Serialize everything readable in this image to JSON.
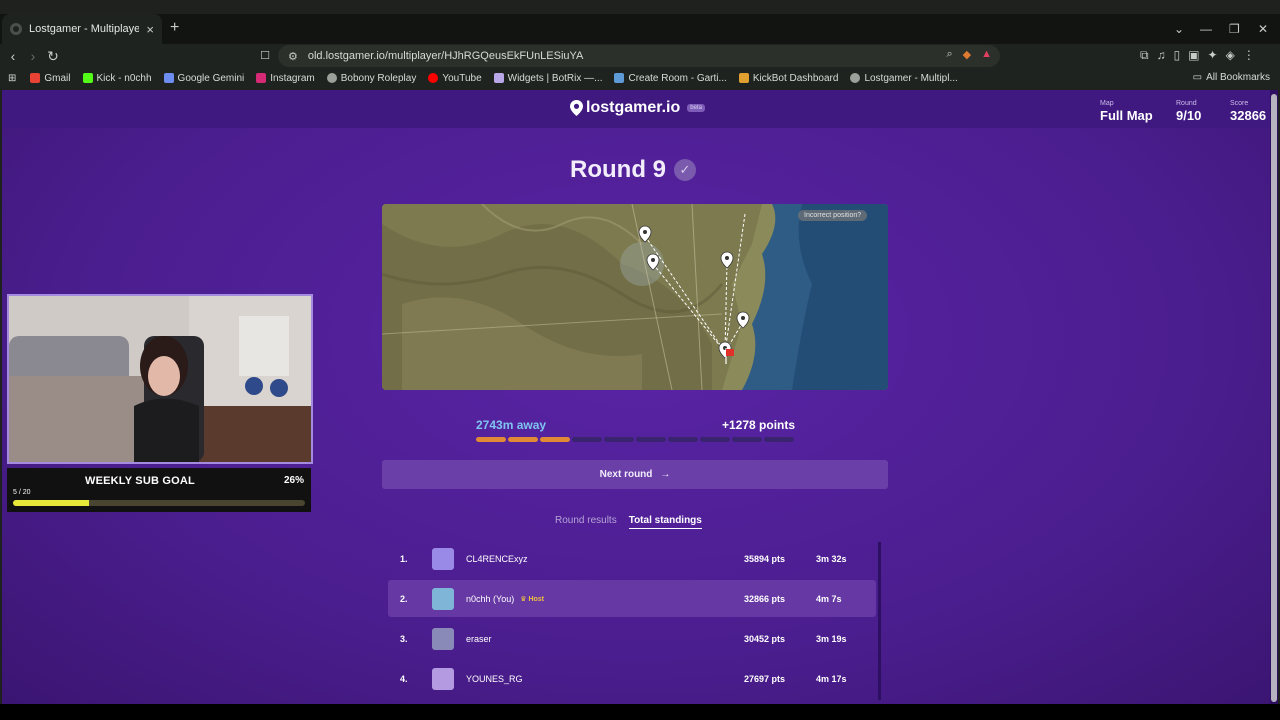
{
  "browser": {
    "tab_title": "Lostgamer - Multiplayer",
    "url": "old.lostgamer.io/multiplayer/HJhRGQeusEkFUnLESiuYA",
    "bookmarks": [
      {
        "label": "Gmail",
        "color": "#ea4335"
      },
      {
        "label": "Kick - n0chh",
        "color": "#53fc18"
      },
      {
        "label": "Google Gemini",
        "color": "#6e8df0"
      },
      {
        "label": "Instagram",
        "color": "#d62976"
      },
      {
        "label": "Bobony Roleplay",
        "color": "#9aa09a"
      },
      {
        "label": "YouTube",
        "color": "#ff0000"
      },
      {
        "label": "Widgets | BotRix —...",
        "color": "#b9a6e8"
      },
      {
        "label": "Create Room - Garti...",
        "color": "#5f9ad8"
      },
      {
        "label": "KickBot Dashboard",
        "color": "#e0a030"
      },
      {
        "label": "Lostgamer - Multipl...",
        "color": "#9aa09a"
      }
    ],
    "all_bookmarks": "All Bookmarks"
  },
  "header": {
    "logo_text": "lostgamer.io",
    "beta": "beta",
    "map_label": "Map",
    "map_value": "Full Map",
    "round_label": "Round",
    "round_value": "9/10",
    "score_label": "Score",
    "score_value": "32866"
  },
  "round": {
    "title": "Round 9",
    "map_tag": "Incorrect position?",
    "distance": "2743m away",
    "points": "+1278 points",
    "score_fraction": 0.3,
    "next_button": "Next round"
  },
  "results_tabs": {
    "round_results": "Round results",
    "total_standings": "Total standings"
  },
  "standings": [
    {
      "rank": "1.",
      "name": "CL4RENCExyz",
      "host": "",
      "pts": "35894 pts",
      "time": "3m 32s",
      "avatar_color": "#9a8ae8",
      "me": false
    },
    {
      "rank": "2.",
      "name": "n0chh (You)",
      "host": "Host",
      "pts": "32866 pts",
      "time": "4m 7s",
      "avatar_color": "#7fb6d8",
      "me": true
    },
    {
      "rank": "3.",
      "name": "eraser",
      "host": "",
      "pts": "30452 pts",
      "time": "3m 19s",
      "avatar_color": "#8a8ab8",
      "me": false
    },
    {
      "rank": "4.",
      "name": "YOUNES_RG",
      "host": "",
      "pts": "27697 pts",
      "time": "4m 17s",
      "avatar_color": "#b49ae0",
      "me": false
    }
  ],
  "stream_overlay": {
    "goal_title": "WEEKLY SUB GOAL",
    "goal_percent": "26%",
    "goal_count": "5 / 20",
    "goal_fraction": 0.26
  }
}
